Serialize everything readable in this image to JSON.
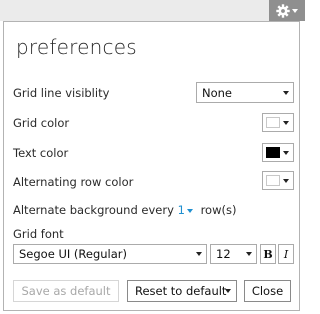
{
  "header": {
    "settings_icon": "gear-icon"
  },
  "dialog": {
    "title": "preferences",
    "grid_line_visibility": {
      "label": "Grid line visiblity",
      "value": "None"
    },
    "grid_color": {
      "label": "Grid color",
      "color": "#ffffff"
    },
    "text_color": {
      "label": "Text color",
      "color": "#000000"
    },
    "alternating_row_color": {
      "label": "Alternating row color",
      "color": "#ffffff"
    },
    "alternate_background": {
      "prefix": "Alternate background every",
      "value": "1",
      "suffix": "row(s)"
    },
    "grid_font": {
      "label": "Grid font",
      "family": "Segoe UI (Regular)",
      "size": "12",
      "bold": "B",
      "italic": "I"
    },
    "buttons": {
      "save_as_default": "Save as default",
      "reset_to_default": "Reset to default",
      "close": "Close"
    }
  }
}
